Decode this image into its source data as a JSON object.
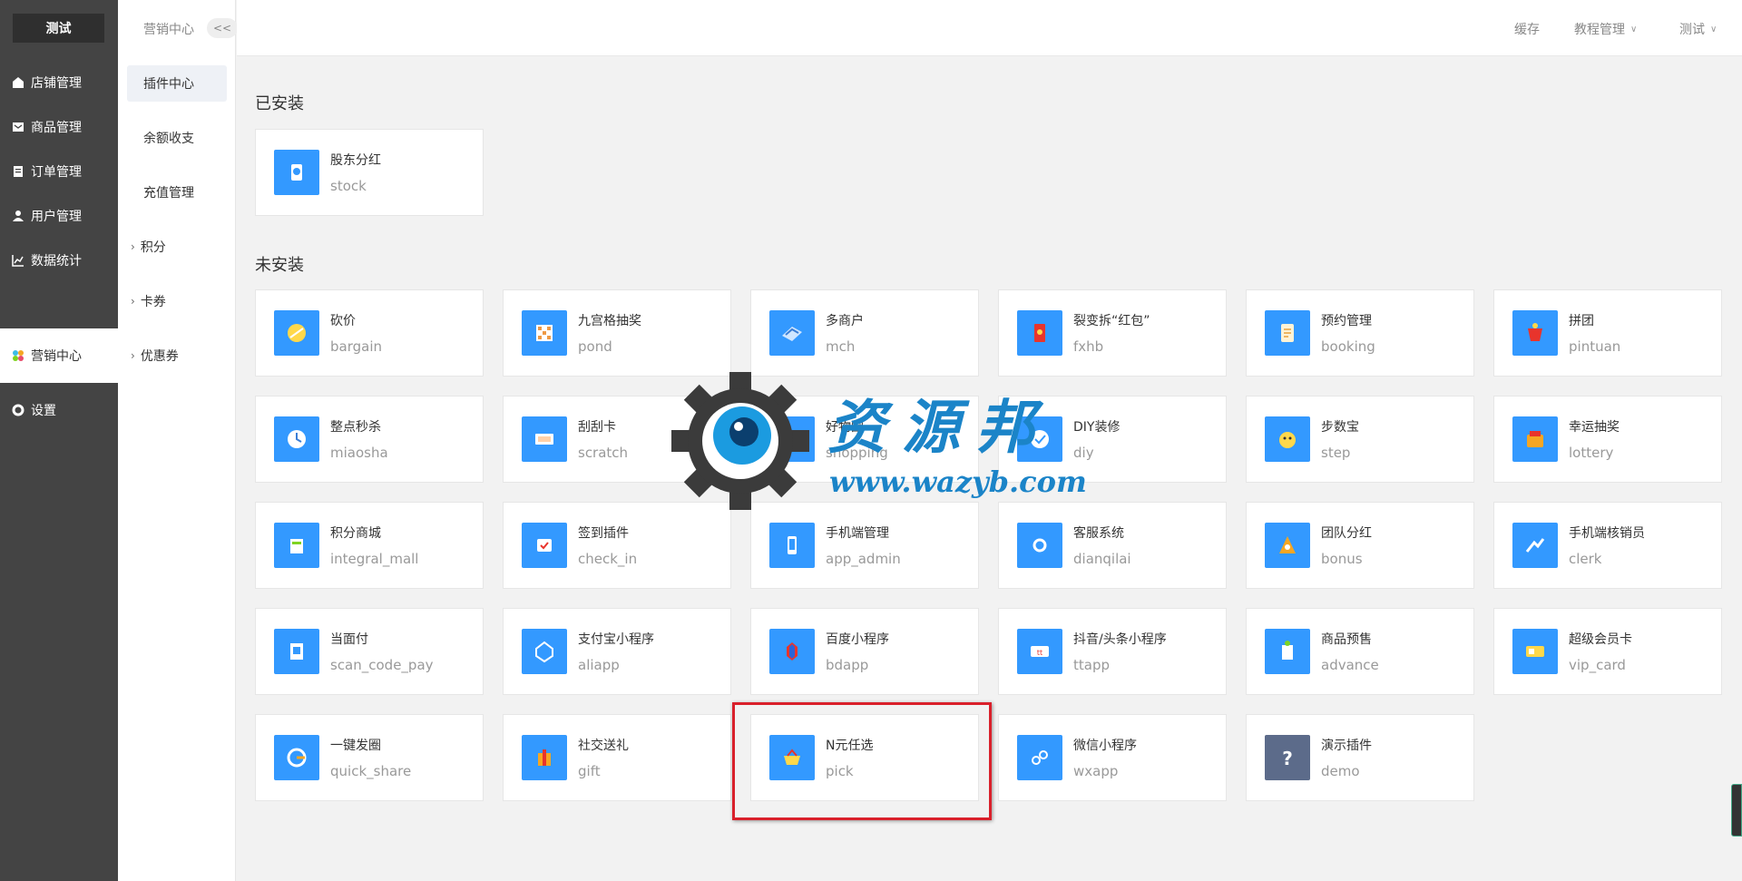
{
  "sidebar": {
    "brand": "测试",
    "items": [
      {
        "label": "店铺管理",
        "icon": "store-icon"
      },
      {
        "label": "商品管理",
        "icon": "goods-icon"
      },
      {
        "label": "订单管理",
        "icon": "order-icon"
      },
      {
        "label": "用户管理",
        "icon": "user-icon"
      },
      {
        "label": "数据统计",
        "icon": "chart-icon"
      },
      {
        "label": "营销中心",
        "icon": "marketing-icon",
        "active": true
      },
      {
        "label": "设置",
        "icon": "gear-icon"
      }
    ]
  },
  "subsidebar": {
    "title": "营销中心",
    "collapse_label": "<<",
    "items": [
      {
        "label": "插件中心",
        "active": true
      },
      {
        "label": "余额收支"
      },
      {
        "label": "充值管理"
      },
      {
        "label": "积分",
        "expandable": true
      },
      {
        "label": "卡券",
        "expandable": true
      },
      {
        "label": "优惠券",
        "expandable": true
      }
    ]
  },
  "topbar": {
    "cache_label": "缓存",
    "tutorial_label": "教程管理",
    "user_label": "测试"
  },
  "main": {
    "installed_title": "已安装",
    "uninstalled_title": "未安装",
    "installed": [
      {
        "cn": "股东分红",
        "en": "stock"
      }
    ],
    "uninstalled": [
      {
        "cn": "砍价",
        "en": "bargain"
      },
      {
        "cn": "九宫格抽奖",
        "en": "pond"
      },
      {
        "cn": "多商户",
        "en": "mch"
      },
      {
        "cn": "裂变拆“红包”",
        "en": "fxhb"
      },
      {
        "cn": "预约管理",
        "en": "booking"
      },
      {
        "cn": "拼团",
        "en": "pintuan"
      },
      {
        "cn": "整点秒杀",
        "en": "miaosha"
      },
      {
        "cn": "刮刮卡",
        "en": "scratch"
      },
      {
        "cn": "好物圈",
        "en": "shopping"
      },
      {
        "cn": "DIY装修",
        "en": "diy"
      },
      {
        "cn": "步数宝",
        "en": "step"
      },
      {
        "cn": "幸运抽奖",
        "en": "lottery"
      },
      {
        "cn": "积分商城",
        "en": "integral_mall"
      },
      {
        "cn": "签到插件",
        "en": "check_in"
      },
      {
        "cn": "手机端管理",
        "en": "app_admin"
      },
      {
        "cn": "客服系统",
        "en": "dianqilai"
      },
      {
        "cn": "团队分红",
        "en": "bonus"
      },
      {
        "cn": "手机端核销员",
        "en": "clerk"
      },
      {
        "cn": "当面付",
        "en": "scan_code_pay"
      },
      {
        "cn": "支付宝小程序",
        "en": "aliapp"
      },
      {
        "cn": "百度小程序",
        "en": "bdapp"
      },
      {
        "cn": "抖音/头条小程序",
        "en": "ttapp"
      },
      {
        "cn": "商品预售",
        "en": "advance"
      },
      {
        "cn": "超级会员卡",
        "en": "vip_card"
      },
      {
        "cn": "一键发圈",
        "en": "quick_share"
      },
      {
        "cn": "社交送礼",
        "en": "gift"
      },
      {
        "cn": "N元任选",
        "en": "pick"
      },
      {
        "cn": "微信小程序",
        "en": "wxapp"
      },
      {
        "cn": "演示插件",
        "en": "demo"
      }
    ]
  },
  "watermark": {
    "cn": "资源邦",
    "url": "www.wazyb.com"
  },
  "colors": {
    "sidebar_bg": "#444444",
    "icon_bg": "#3399ff",
    "highlight": "#d9202b",
    "watermark": "#1b84c8"
  }
}
